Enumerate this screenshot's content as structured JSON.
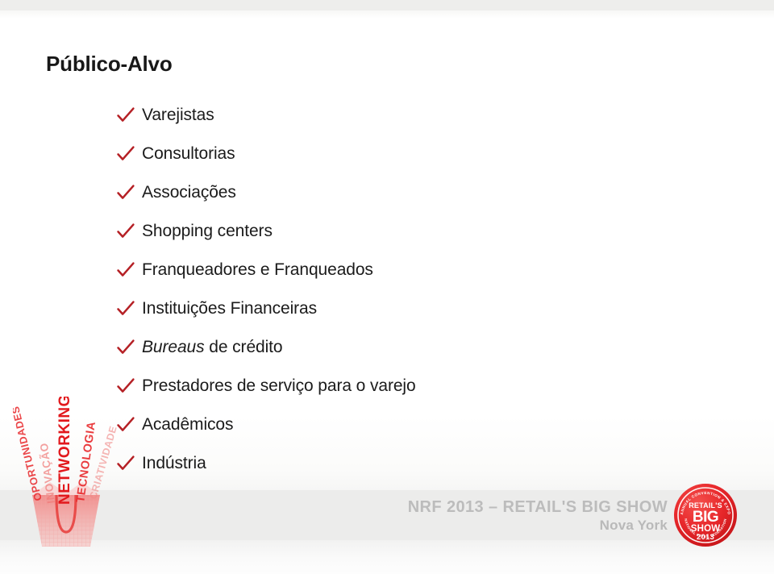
{
  "slide": {
    "title": "Público-Alvo",
    "bullets": [
      {
        "icon": "check-icon",
        "text": "Varejistas",
        "italic_prefix": ""
      },
      {
        "icon": "check-icon",
        "text": "Consultorias",
        "italic_prefix": ""
      },
      {
        "icon": "check-icon",
        "text": "Associações",
        "italic_prefix": ""
      },
      {
        "icon": "check-icon",
        "text": "Shopping centers",
        "italic_prefix": ""
      },
      {
        "icon": "check-icon",
        "text": "Franqueadores e Franqueados",
        "italic_prefix": ""
      },
      {
        "icon": "check-icon",
        "text": "Instituições Financeiras",
        "italic_prefix": ""
      },
      {
        "icon": "check-icon",
        "text": " de crédito",
        "italic_prefix": "Bureaus"
      },
      {
        "icon": "check-icon",
        "text": "Prestadores de serviço para o varejo",
        "italic_prefix": ""
      },
      {
        "icon": "check-icon",
        "text": "Acadêmicos",
        "italic_prefix": ""
      },
      {
        "icon": "check-icon",
        "text": "Indústria",
        "italic_prefix": ""
      }
    ]
  },
  "footer": {
    "line1": "NRF 2013 – RETAIL'S BIG SHOW",
    "line2": "Nova York"
  },
  "logo": {
    "name": "retails-big-show-2013-seal",
    "arc_top_text": "ANNUAL CONVENTION & EXPO",
    "line1": "RETAIL'S",
    "line2": "BIG",
    "line3": "SHOW",
    "line4": "2013",
    "arc_bottom_text": "NATIONAL RETAIL FEDERATION"
  },
  "bag_graphic": {
    "name": "shopping-bag-wordcloud",
    "words": [
      "OPORTUNIDADES",
      "INOVAÇÃO",
      "NETWORKING",
      "TECNOLOGIA",
      "CRIATIVIDADE"
    ]
  },
  "colors": {
    "check_red": "#b52025",
    "brand_red": "#e8282b",
    "title_black": "#181818",
    "body_black": "#1b1b1b",
    "footer_gray": "#bcbcbc",
    "band_gray": "#ececeb"
  }
}
